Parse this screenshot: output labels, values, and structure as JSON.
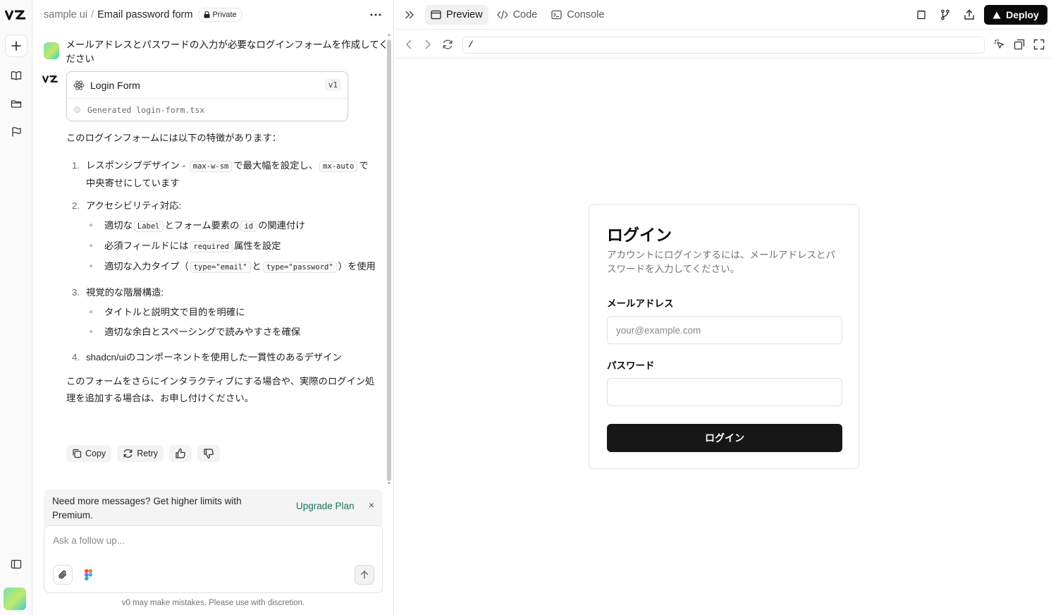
{
  "rail": {
    "logo": "v0-logo",
    "items": [
      "new-chat-icon",
      "library-icon",
      "folder-icon",
      "flag-icon"
    ],
    "panel_toggle": "sidebar-panel-icon"
  },
  "header": {
    "project": "sample ui",
    "separator": "/",
    "title": "Email password form",
    "badge": "Private"
  },
  "chat": {
    "user_message": "メールアドレスとパスワードの入力が必要なログインフォームを作成してください",
    "generation": {
      "title": "Login Form",
      "version": "v1",
      "status": "Generated login-form.tsx"
    },
    "intro": "このログインフォームには以下の特徴があります：",
    "points": {
      "p1": {
        "num": "1.",
        "a": "レスポンシブデザイン - ",
        "code1": "max-w-sm",
        "b": "で最大幅を設定し、",
        "code2": "mx-auto",
        "c": "で中央寄せにしています"
      },
      "p2": {
        "num": "2.",
        "title": "アクセシビリティ対応:",
        "s1": {
          "a": "適切な",
          "code1": "Label",
          "b": "とフォーム要素の",
          "code2": "id",
          "c": "の関連付け"
        },
        "s2": {
          "a": "必須フィールドには",
          "code1": "required",
          "b": "属性を設定"
        },
        "s3": {
          "a": "適切な入力タイプ（",
          "code1": "type=\"email\"",
          "b": "と",
          "code2": "type=\"password\"",
          "c": "）を使用"
        }
      },
      "p3": {
        "num": "3.",
        "title": "視覚的な階層構造:",
        "s1": "タイトルと説明文で目的を明確に",
        "s2": "適切な余白とスペーシングで読みやすさを確保"
      },
      "p4": {
        "num": "4.",
        "text": "shadcn/uiのコンポーネントを使用した一貫性のあるデザイン"
      }
    },
    "closing": "このフォームをさらにインタラクティブにする場合や、実際のログイン処理を追加する場合は、お申し付けください。",
    "actions": {
      "copy": "Copy",
      "retry": "Retry"
    }
  },
  "upgrade": {
    "text": "Need more messages? Get higher limits with Premium.",
    "link": "Upgrade Plan",
    "close": "×"
  },
  "composer": {
    "placeholder": "Ask a follow up...",
    "disclaimer": "v0 may make mistakes. Please use with discretion."
  },
  "topbar": {
    "tabs": [
      {
        "label": "Preview",
        "icon": "preview-icon",
        "active": true
      },
      {
        "label": "Code",
        "icon": "code-icon",
        "active": false
      },
      {
        "label": "Console",
        "icon": "console-icon",
        "active": false
      }
    ],
    "deploy": "Deploy"
  },
  "urlbar": {
    "path": "/"
  },
  "preview": {
    "title": "ログイン",
    "description": "アカウントにログインするには、メールアドレスとパスワードを入力してください。",
    "email_label": "メールアドレス",
    "email_placeholder": "your@example.com",
    "password_label": "パスワード",
    "password_value": "",
    "submit": "ログイン"
  },
  "colors": {
    "accent_link": "#17745d",
    "deploy_bg": "#0a0a0a",
    "submit_bg": "#171717"
  }
}
